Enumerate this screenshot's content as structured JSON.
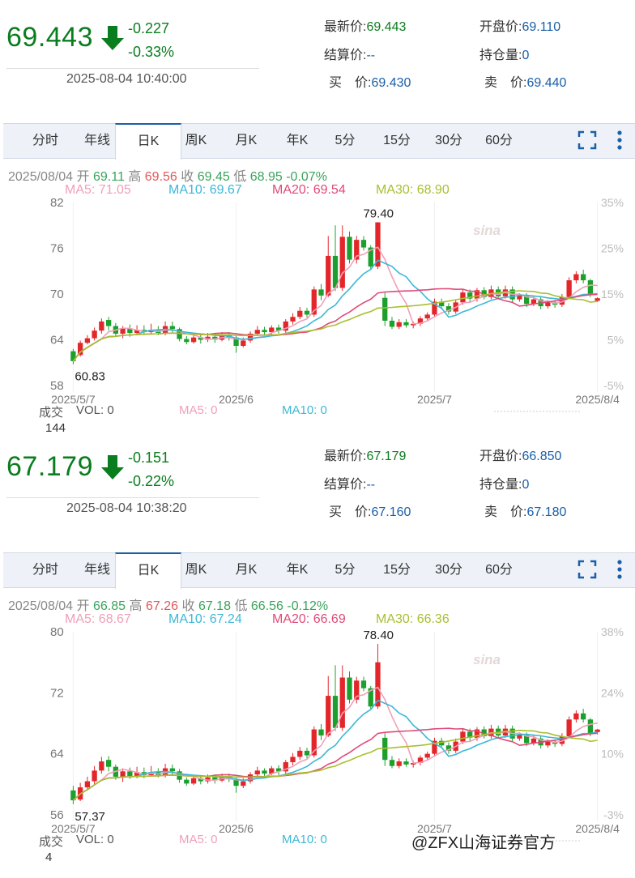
{
  "tabs": [
    "分时",
    "年线",
    "日K",
    "周K",
    "月K",
    "年K",
    "5分",
    "15分",
    "30分",
    "60分"
  ],
  "active_tab": 2,
  "labels": {
    "latest": "最新价:",
    "open": "开盘价:",
    "settle": "结算价:",
    "oi": "持仓量:",
    "bid": "买　价:",
    "ask": "卖　价:",
    "vol_title": "成交",
    "vol": "VOL: 0",
    "ma5vol": "MA5: 0",
    "ma10vol": "MA10: 0"
  },
  "colors": {
    "up": "#e3262a",
    "down": "#1ca02d",
    "ma5": "#f0a0b8",
    "ma10": "#3cb8d8",
    "ma20": "#e04a78",
    "ma30": "#a8c030",
    "price": "#0a7d1e",
    "link": "#1a5fa8"
  },
  "watermark": "@ZFX山海证券官方",
  "panels": [
    {
      "price": "69.443",
      "change": "-0.227",
      "change_pct": "-0.33%",
      "timestamp": "2025-08-04 10:40:00",
      "latest": "69.443",
      "open": "69.110",
      "settle": "--",
      "oi": "0",
      "bid": "69.430",
      "ask": "69.440",
      "info": {
        "date": "2025/08/04",
        "open_l": "开",
        "open": "69.11",
        "high_l": "高",
        "high": "69.56",
        "close_l": "收",
        "close": "69.45",
        "low_l": "低",
        "low": "68.95",
        "pct": "-0.07%"
      },
      "ma": {
        "ma5": "MA5: 71.05",
        "ma10": "MA10: 69.67",
        "ma20": "MA20: 69.54",
        "ma30": "MA30: 68.90"
      },
      "vol_axis": "144",
      "chart_data": {
        "type": "candlestick",
        "y_ticks": [
          "82",
          "76",
          "70",
          "64",
          "58"
        ],
        "ylim": [
          58,
          82
        ],
        "right_ticks": [
          "35%",
          "25%",
          "15%",
          "5%",
          "-5%"
        ],
        "x_ticks": [
          "2025/5/7",
          "2025/6",
          "2025/7",
          "2025/8/4"
        ],
        "annotations": {
          "max": "79.40",
          "min": "60.83"
        },
        "ohlc": [
          [
            62.5,
            61.2,
            62.8,
            60.8
          ],
          [
            62.0,
            63.6,
            63.9,
            61.8
          ],
          [
            63.6,
            64.2,
            64.6,
            63.4
          ],
          [
            64.2,
            65.2,
            65.6,
            63.9
          ],
          [
            65.2,
            66.4,
            66.8,
            64.8
          ],
          [
            66.6,
            65.8,
            67.0,
            65.2
          ],
          [
            65.8,
            64.8,
            66.2,
            64.5
          ],
          [
            64.8,
            65.5,
            65.8,
            64.2
          ],
          [
            65.5,
            64.9,
            66.0,
            64.4
          ],
          [
            64.9,
            65.3,
            65.9,
            64.6
          ],
          [
            65.3,
            65.0,
            65.9,
            64.6
          ],
          [
            65.0,
            65.3,
            66.1,
            64.8
          ],
          [
            65.3,
            64.9,
            65.8,
            64.6
          ],
          [
            64.9,
            65.8,
            66.4,
            64.6
          ],
          [
            65.8,
            65.4,
            66.4,
            65.0
          ],
          [
            65.4,
            64.1,
            65.6,
            63.8
          ],
          [
            64.1,
            63.7,
            64.5,
            63.4
          ],
          [
            63.7,
            64.3,
            64.6,
            63.5
          ],
          [
            64.3,
            64.0,
            64.7,
            63.5
          ],
          [
            64.0,
            64.4,
            64.9,
            63.7
          ],
          [
            64.4,
            64.0,
            64.9,
            63.6
          ],
          [
            64.0,
            64.7,
            65.0,
            63.8
          ],
          [
            64.7,
            64.3,
            65.0,
            63.9
          ],
          [
            64.3,
            63.2,
            64.6,
            62.3
          ],
          [
            63.2,
            63.9,
            64.3,
            63.0
          ],
          [
            63.9,
            64.8,
            65.1,
            63.6
          ],
          [
            64.8,
            65.3,
            65.8,
            64.5
          ],
          [
            65.3,
            65.0,
            65.7,
            64.6
          ],
          [
            65.0,
            65.6,
            65.9,
            64.7
          ],
          [
            65.6,
            65.2,
            66.0,
            64.8
          ],
          [
            65.2,
            66.4,
            66.7,
            64.9
          ],
          [
            66.4,
            67.0,
            67.5,
            66.0
          ],
          [
            67.0,
            67.8,
            68.3,
            66.7
          ],
          [
            67.8,
            67.3,
            68.2,
            66.9
          ],
          [
            67.3,
            70.6,
            71.0,
            67.0
          ],
          [
            70.6,
            69.8,
            71.3,
            69.2
          ],
          [
            69.8,
            75.0,
            77.6,
            69.6
          ],
          [
            75.0,
            70.8,
            79.0,
            70.4
          ],
          [
            70.8,
            77.5,
            79.0,
            70.4
          ],
          [
            77.5,
            74.5,
            78.2,
            74.0
          ],
          [
            74.5,
            77.1,
            77.6,
            74.0
          ],
          [
            77.1,
            76.1,
            77.6,
            75.7
          ],
          [
            76.1,
            73.6,
            76.4,
            73.3
          ],
          [
            73.6,
            79.4,
            79.4,
            73.3
          ],
          [
            69.5,
            66.5,
            70.2,
            65.8
          ],
          [
            66.5,
            65.7,
            67.0,
            65.4
          ],
          [
            65.7,
            66.3,
            66.7,
            65.4
          ],
          [
            66.3,
            65.9,
            66.7,
            65.6
          ],
          [
            65.9,
            66.1,
            66.4,
            65.5
          ],
          [
            66.1,
            66.8,
            67.1,
            65.8
          ],
          [
            66.8,
            67.3,
            67.6,
            66.5
          ],
          [
            67.3,
            69.0,
            69.4,
            67.0
          ],
          [
            69.0,
            68.4,
            69.4,
            68.0
          ],
          [
            68.4,
            67.7,
            68.8,
            67.3
          ],
          [
            67.7,
            68.9,
            69.3,
            67.4
          ],
          [
            68.9,
            70.2,
            70.6,
            68.6
          ],
          [
            70.2,
            69.4,
            70.6,
            69.0
          ],
          [
            69.4,
            70.5,
            70.8,
            69.0
          ],
          [
            70.5,
            69.6,
            70.9,
            69.3
          ],
          [
            69.6,
            70.6,
            71.1,
            69.3
          ],
          [
            70.6,
            69.7,
            71.0,
            69.3
          ],
          [
            69.7,
            70.6,
            71.1,
            69.4
          ],
          [
            70.6,
            69.3,
            71.0,
            68.9
          ],
          [
            69.3,
            69.8,
            70.1,
            69.0
          ],
          [
            69.8,
            68.7,
            70.1,
            68.3
          ],
          [
            68.7,
            69.3,
            69.7,
            68.4
          ],
          [
            69.3,
            68.4,
            69.6,
            68.0
          ],
          [
            68.4,
            68.9,
            69.2,
            68.1
          ],
          [
            68.9,
            68.6,
            69.2,
            68.2
          ],
          [
            68.6,
            69.6,
            70.0,
            68.3
          ],
          [
            69.6,
            71.8,
            72.2,
            69.4
          ],
          [
            71.8,
            72.6,
            73.0,
            71.4
          ],
          [
            72.6,
            71.8,
            73.2,
            71.4
          ],
          [
            71.8,
            70.0,
            72.0,
            69.6
          ],
          [
            69.11,
            69.45,
            69.56,
            68.95
          ]
        ]
      }
    },
    {
      "price": "67.179",
      "change": "-0.151",
      "change_pct": "-0.22%",
      "timestamp": "2025-08-04 10:38:20",
      "latest": "67.179",
      "open": "66.850",
      "settle": "--",
      "oi": "0",
      "bid": "67.160",
      "ask": "67.180",
      "info": {
        "date": "2025/08/04",
        "open_l": "开",
        "open": "66.85",
        "high_l": "高",
        "high": "67.26",
        "close_l": "收",
        "close": "67.18",
        "low_l": "低",
        "low": "66.56",
        "pct": "-0.12%"
      },
      "ma": {
        "ma5": "MA5: 68.67",
        "ma10": "MA10: 67.24",
        "ma20": "MA20: 66.69",
        "ma30": "MA30: 66.36"
      },
      "vol_axis": "4",
      "chart_data": {
        "type": "candlestick",
        "y_ticks": [
          "80",
          "72",
          "64",
          "56"
        ],
        "ylim": [
          56,
          80
        ],
        "right_ticks": [
          "38%",
          "24%",
          "10%",
          "-3%"
        ],
        "x_ticks": [
          "2025/5/7",
          "2025/6",
          "2025/7",
          "2025/8/4"
        ],
        "annotations": {
          "max": "78.40",
          "min": "57.37"
        },
        "ohlc": [
          [
            59.2,
            57.9,
            59.8,
            57.4
          ],
          [
            58.0,
            59.6,
            60.2,
            57.8
          ],
          [
            59.6,
            60.4,
            61.0,
            59.2
          ],
          [
            60.4,
            61.8,
            62.4,
            59.9
          ],
          [
            61.8,
            63.0,
            63.6,
            61.4
          ],
          [
            63.2,
            62.3,
            63.7,
            61.7
          ],
          [
            62.3,
            61.0,
            62.6,
            60.6
          ],
          [
            61.0,
            61.7,
            62.1,
            60.3
          ],
          [
            61.7,
            61.1,
            62.2,
            60.7
          ],
          [
            61.1,
            61.6,
            62.3,
            60.8
          ],
          [
            61.6,
            61.2,
            62.2,
            60.8
          ],
          [
            61.2,
            61.6,
            62.4,
            61.0
          ],
          [
            61.6,
            61.2,
            62.1,
            60.9
          ],
          [
            61.2,
            62.1,
            62.7,
            60.9
          ],
          [
            62.1,
            61.7,
            62.6,
            61.3
          ],
          [
            61.7,
            60.6,
            62.0,
            60.2
          ],
          [
            60.6,
            60.1,
            60.9,
            59.8
          ],
          [
            60.1,
            60.8,
            61.0,
            59.9
          ],
          [
            60.8,
            60.4,
            61.2,
            60.0
          ],
          [
            60.4,
            60.9,
            61.3,
            60.1
          ],
          [
            60.9,
            60.5,
            61.3,
            60.1
          ],
          [
            60.5,
            61.1,
            61.4,
            60.3
          ],
          [
            61.1,
            60.7,
            61.4,
            60.3
          ],
          [
            60.7,
            59.8,
            61.0,
            58.9
          ],
          [
            59.8,
            60.4,
            60.8,
            59.5
          ],
          [
            60.4,
            61.3,
            61.6,
            60.1
          ],
          [
            61.3,
            61.8,
            62.3,
            61.0
          ],
          [
            61.8,
            61.4,
            62.1,
            61.0
          ],
          [
            61.4,
            62.1,
            62.4,
            61.2
          ],
          [
            62.1,
            61.7,
            62.5,
            61.2
          ],
          [
            61.7,
            62.9,
            63.2,
            61.4
          ],
          [
            62.9,
            63.6,
            64.1,
            62.5
          ],
          [
            63.6,
            64.4,
            64.9,
            63.2
          ],
          [
            64.4,
            63.8,
            64.8,
            63.4
          ],
          [
            63.8,
            67.2,
            67.6,
            63.5
          ],
          [
            67.2,
            66.4,
            67.9,
            65.8
          ],
          [
            66.4,
            71.6,
            74.2,
            66.2
          ],
          [
            71.6,
            67.4,
            75.6,
            67.0
          ],
          [
            67.4,
            74.0,
            75.6,
            67.0
          ],
          [
            74.0,
            71.1,
            74.8,
            70.6
          ],
          [
            71.1,
            73.6,
            74.1,
            70.6
          ],
          [
            73.6,
            72.6,
            74.1,
            72.2
          ],
          [
            72.6,
            70.2,
            72.9,
            69.9
          ],
          [
            70.2,
            76.0,
            78.4,
            69.9
          ],
          [
            66.1,
            63.2,
            66.8,
            62.4
          ],
          [
            63.2,
            62.4,
            63.7,
            62.1
          ],
          [
            62.4,
            63.0,
            63.4,
            62.1
          ],
          [
            63.0,
            62.6,
            63.4,
            62.3
          ],
          [
            62.6,
            62.8,
            63.1,
            62.2
          ],
          [
            62.8,
            63.5,
            63.8,
            62.5
          ],
          [
            63.5,
            64.0,
            64.3,
            63.2
          ],
          [
            64.0,
            65.7,
            66.1,
            63.7
          ],
          [
            65.7,
            65.1,
            66.1,
            64.7
          ],
          [
            65.1,
            64.4,
            65.5,
            64.0
          ],
          [
            64.4,
            65.6,
            66.0,
            64.1
          ],
          [
            65.6,
            66.9,
            67.3,
            65.3
          ],
          [
            66.9,
            66.1,
            67.3,
            65.7
          ],
          [
            66.1,
            67.2,
            67.5,
            65.7
          ],
          [
            67.2,
            66.3,
            67.6,
            66.0
          ],
          [
            66.3,
            67.3,
            67.8,
            66.0
          ],
          [
            67.3,
            66.4,
            67.7,
            66.0
          ],
          [
            66.4,
            67.3,
            67.8,
            66.1
          ],
          [
            67.3,
            66.0,
            67.7,
            65.6
          ],
          [
            66.0,
            66.5,
            66.8,
            65.7
          ],
          [
            66.5,
            65.4,
            66.8,
            65.0
          ],
          [
            65.4,
            66.0,
            66.4,
            65.1
          ],
          [
            66.0,
            65.1,
            66.3,
            64.7
          ],
          [
            65.1,
            65.6,
            65.9,
            64.8
          ],
          [
            65.6,
            65.3,
            65.9,
            64.9
          ],
          [
            65.3,
            66.3,
            66.7,
            65.0
          ],
          [
            66.3,
            68.5,
            68.9,
            66.1
          ],
          [
            68.5,
            69.3,
            69.7,
            68.1
          ],
          [
            69.3,
            68.5,
            69.9,
            68.1
          ],
          [
            68.5,
            66.7,
            68.7,
            66.3
          ],
          [
            66.85,
            67.18,
            67.26,
            66.56
          ]
        ]
      }
    }
  ]
}
